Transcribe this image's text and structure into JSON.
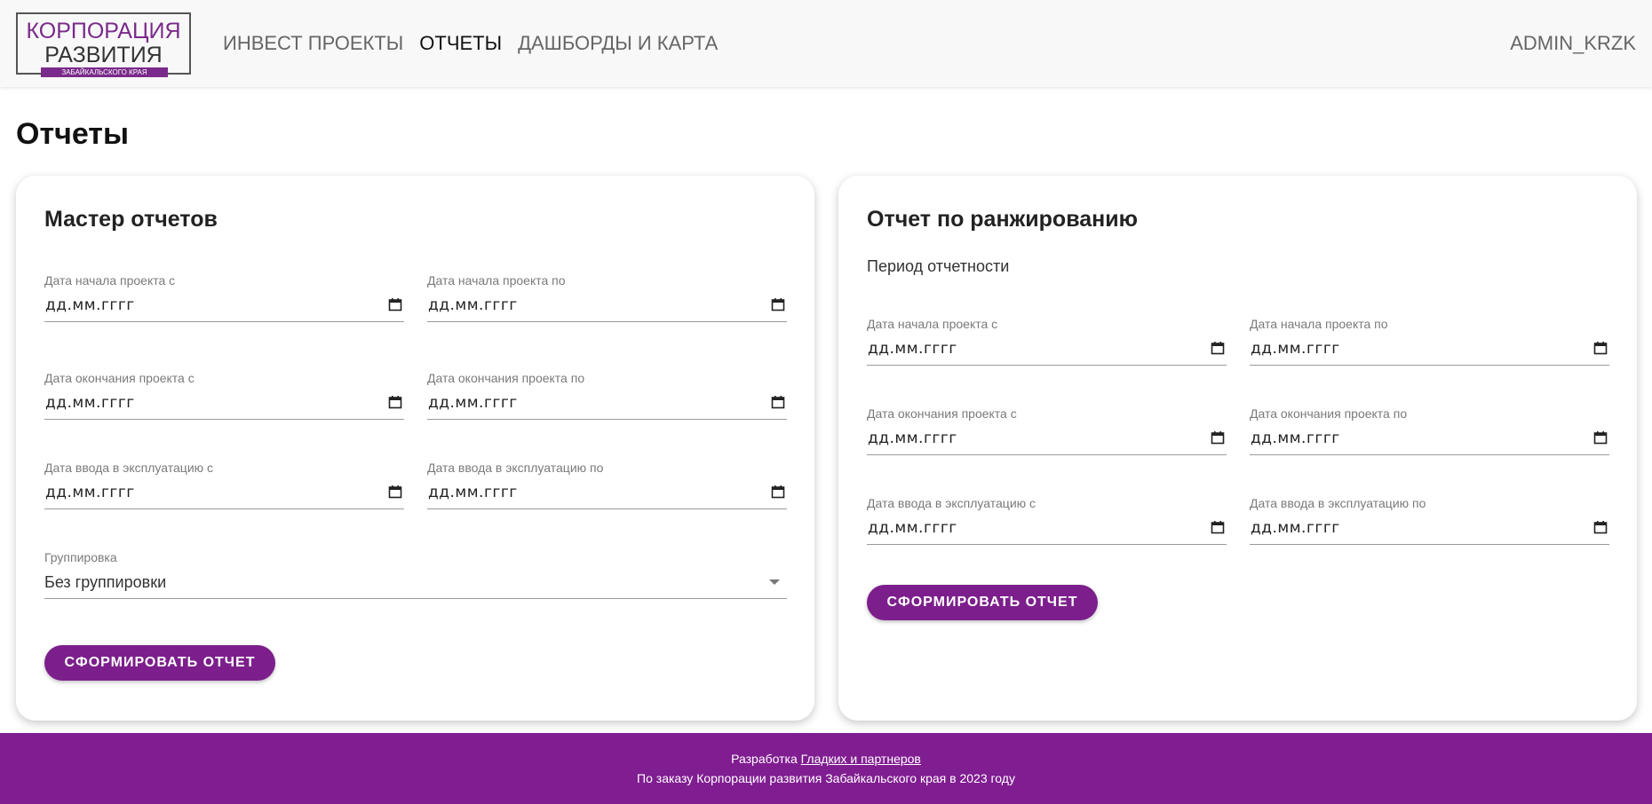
{
  "logo": {
    "line1": "КОРПОРАЦИЯ",
    "line2": "РАЗВИТИЯ",
    "line3": "ЗАБАЙКАЛЬСКОГО КРАЯ",
    "brand_color": "#7a2a8a"
  },
  "nav": {
    "items": [
      {
        "label": "ИНВЕСТ ПРОЕКТЫ",
        "active": false
      },
      {
        "label": "ОТЧЕТЫ",
        "active": true
      },
      {
        "label": "ДАШБОРДЫ И КАРТА",
        "active": false
      }
    ],
    "user": "ADMIN_KRZK"
  },
  "page": {
    "title": "Отчеты"
  },
  "master": {
    "title": "Мастер отчетов",
    "fields": [
      {
        "label": "Дата начала проекта с",
        "value": "дд.мм.гггг"
      },
      {
        "label": "Дата начала проекта по",
        "value": "дд.мм.гггг"
      },
      {
        "label": "Дата окончания проекта с",
        "value": "дд.мм.гггг"
      },
      {
        "label": "Дата окончания проекта по",
        "value": "дд.мм.гггг"
      },
      {
        "label": "Дата ввода в эксплуатацию с",
        "value": "дд.мм.гггг"
      },
      {
        "label": "Дата ввода в эксплуатацию по",
        "value": "дд.мм.гггг"
      }
    ],
    "grouping": {
      "label": "Группировка",
      "value": "Без группировки"
    },
    "button": "СФОРМИРОВАТЬ ОТЧЕТ"
  },
  "ranking": {
    "title": "Отчет по ранжированию",
    "subtitle": "Период отчетности",
    "fields": [
      {
        "label": "Дата начала проекта с",
        "value": "дд.мм.гггг"
      },
      {
        "label": "Дата начала проекта по",
        "value": "дд.мм.гггг"
      },
      {
        "label": "Дата окончания проекта с",
        "value": "дд.мм.гггг"
      },
      {
        "label": "Дата окончания проекта по",
        "value": "дд.мм.гггг"
      },
      {
        "label": "Дата ввода в эксплуатацию с",
        "value": "дд.мм.гггг"
      },
      {
        "label": "Дата ввода в эксплуатацию по",
        "value": "дд.мм.гггг"
      }
    ],
    "button": "СФОРМИРОВАТЬ ОТЧЕТ"
  },
  "footer": {
    "dev_prefix": "Разработка",
    "dev_link": "Гладких и партнеров",
    "line2": "По заказу Корпорации развития Забайкальского края в 2023 году",
    "bg_color": "#801d91"
  },
  "colors": {
    "accent": "#7c1f8c"
  }
}
